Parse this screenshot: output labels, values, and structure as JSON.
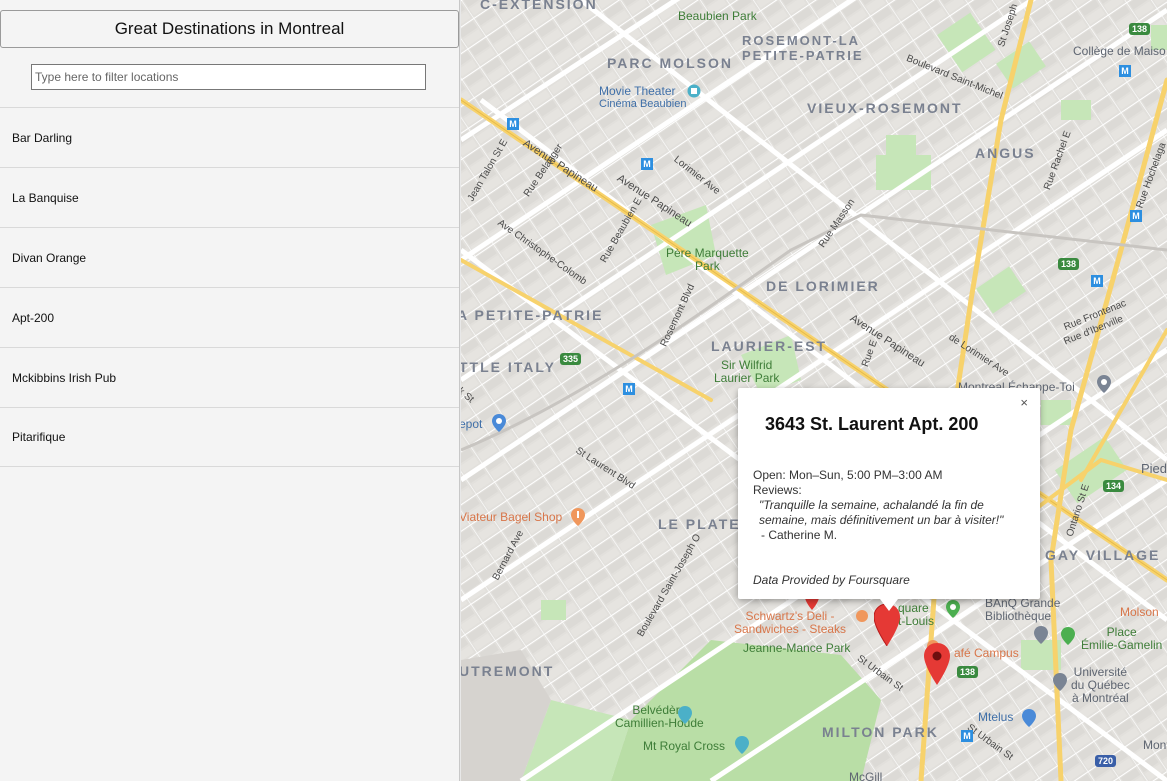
{
  "sidebar": {
    "title": "Great Destinations in Montreal",
    "filter_placeholder": "Type here to filter locations",
    "locations": [
      "Bar Darling",
      "La Banquise",
      "Divan Orange",
      "Apt-200",
      "Mckibbins Irish Pub",
      "Pitarifique"
    ]
  },
  "map": {
    "neighborhoods": {
      "extension": "C-EXTENSION",
      "parc_molson": "PARC MOLSON",
      "rosemont_1": "ROSEMONT-LA",
      "rosemont_2": "PETITE-PATRIE",
      "vieux_rosemont": "VIEUX-ROSEMONT",
      "angus": "ANGUS",
      "de_lorimier": "DE LORIMIER",
      "petite_patrie": "A PETITE-PATRIE",
      "laurier_est": "LAURIER-EST",
      "little_italy": "TTLE ITALY",
      "le_plateau": "LE PLATEAU",
      "gay_village": "GAY VILLAGE",
      "outremont": "UTREMONT",
      "milton_park": "MILTON PARK"
    },
    "places": {
      "beaubien_park": "Beaubien Park",
      "college": "Collège de Maiso",
      "movie_1": "Movie Theater",
      "movie_2": "Cinéma Beaubien",
      "pere_1": "Père Marquette",
      "pere_2": "Park",
      "wilfrid_1": "Sir Wilfrid",
      "wilfrid_2": "Laurier Park",
      "echappe": "Montreal Échappe-Toi",
      "depot": "epot",
      "viateur": "Viateur Bagel Shop",
      "schwartz_1": "Schwartz's Deli -",
      "schwartz_2": "Sandwiches - Steaks",
      "square_1": "quare",
      "square_2": "t-Louis",
      "banq_1": "BAnQ Grande",
      "banq_2": "Bibliothèque",
      "cafe_campus": "afé Campus",
      "molson": "Molson",
      "place_1": "Place",
      "place_2": "Émilie-Gamelin",
      "jeanne": "Jeanne-Mance Park",
      "uqam_1": "Université",
      "uqam_2": "du Québec",
      "uqam_3": "à Montréal",
      "mtelus": "Mtelus",
      "belvedere_1": "Belvédère",
      "belvedere_2": "Camillien-Houde",
      "royal_cross": "Mt Royal Cross",
      "mcgill": "McGill",
      "pied": "Pied",
      "mont": "Mont"
    },
    "streets": {
      "papineau_1": "Avenue Papineau",
      "papineau_2": "Avenue Papineau",
      "papineau_3": "Avenue Papineau",
      "st_michel": "Boulevard Saint-Michel",
      "st_joseph": "St Joseph",
      "lorimier": "Lorimier Ave",
      "belanger": "Rue Belanger",
      "beaubien_e": "Rue Beaubien E",
      "jean_talon": "Jean Talon St E",
      "christophe": "Ave Christophe-Colomb",
      "masson": "Rue Masson",
      "rosemont_blvd": "Rosemont Blvd",
      "rachel": "Rue Rachel E",
      "hochelaga": "Rue Hochelaga",
      "frontenac": "Rue Frontenac",
      "iberville": "Rue d'Iberville",
      "lorimier_2": "de Lorimier Ave",
      "st_laurent": "St Laurent Blvd",
      "bernard": "Bernard Ave",
      "st_joseph_o": "Boulevard Saint-Joseph O",
      "st_urbain": "St Urbain St",
      "st_urbain_2": "St Urbain St",
      "ontario": "Ontario St E",
      "kst": "k St",
      "rue_e": "Rue E"
    },
    "shields": [
      "138",
      "138",
      "335",
      "134",
      "138",
      "720"
    ]
  },
  "infowindow": {
    "title": "3643 St. Laurent Apt. 200",
    "close": "×",
    "hours": "Open: Mon–Sun, 5:00 PM–3:00 AM",
    "reviews_label": "Reviews:",
    "review": "\"Tranquille la semaine, achalandé la fin de semaine, mais définitivement un bar à visiter!\"",
    "author": "- Catherine M.",
    "credit": "Data Provided by Foursquare"
  },
  "colors": {
    "marker": "#e53935",
    "park": "#c3e6b4",
    "highway": "#f7d26c",
    "metro": "#2d8fe0"
  }
}
